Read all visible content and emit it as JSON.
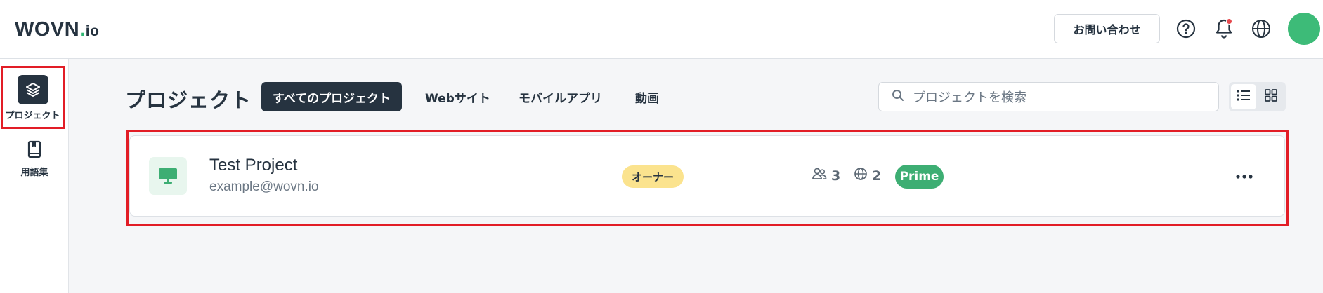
{
  "header": {
    "logo_main": "WOVN",
    "logo_dot": ".",
    "logo_suffix": "io",
    "contact_label": "お問い合わせ",
    "icons": [
      "help-icon",
      "bell-icon",
      "globe-icon",
      "avatar"
    ],
    "notification_dot_color": "#e5484d",
    "avatar_color": "#3dbb78"
  },
  "sidebar": {
    "items": [
      {
        "label": "プロジェクト",
        "icon": "layers-icon",
        "active": true
      },
      {
        "label": "用語集",
        "icon": "book-icon",
        "active": false
      }
    ]
  },
  "main": {
    "title": "プロジェクト",
    "tabs": [
      {
        "label": "すべてのプロジェクト",
        "active": true
      },
      {
        "label": "Webサイト",
        "active": false
      },
      {
        "label": "モバイルアプリ",
        "active": false
      },
      {
        "label": "動画",
        "active": false
      }
    ],
    "search": {
      "placeholder": "プロジェクトを検索",
      "icon": "search-icon"
    },
    "view_modes": [
      {
        "name": "list",
        "icon": "list-icon",
        "active": true
      },
      {
        "name": "grid",
        "icon": "grid-icon",
        "active": false
      }
    ]
  },
  "projects": [
    {
      "name": "Test Project",
      "email": "example@wovn.io",
      "role": "オーナー",
      "members": "3",
      "languages": "2",
      "plan": "Prime",
      "icon": "monitor-icon"
    }
  ],
  "colors": {
    "dark": "#263340",
    "accent_green": "#3dae73",
    "owner_badge": "#fbe38e",
    "highlight_red": "#e21d26"
  }
}
